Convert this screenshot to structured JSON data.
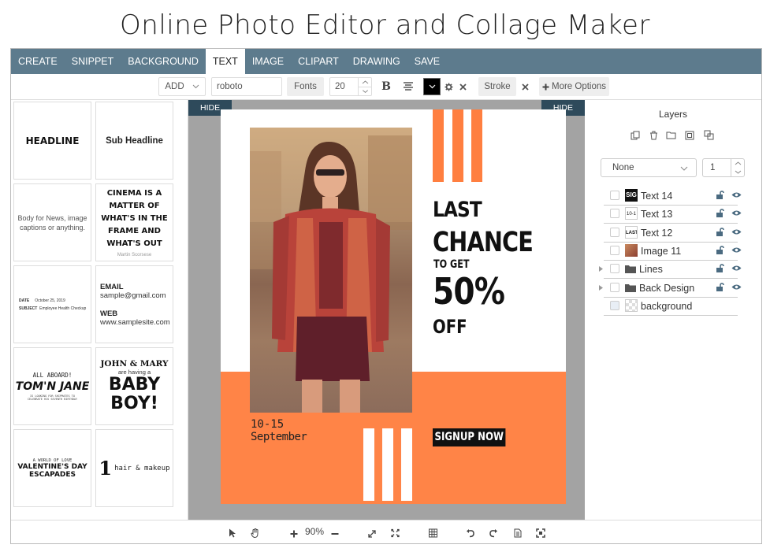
{
  "page": {
    "title": "Online Photo Editor and Collage Maker"
  },
  "menu": {
    "items": [
      {
        "label": "CREATE"
      },
      {
        "label": "SNIPPET"
      },
      {
        "label": "BACKGROUND"
      },
      {
        "label": "TEXT",
        "active": true
      },
      {
        "label": "IMAGE"
      },
      {
        "label": "CLIPART"
      },
      {
        "label": "DRAWING"
      },
      {
        "label": "SAVE"
      }
    ]
  },
  "toolbar": {
    "add_label": "ADD",
    "font_value": "roboto",
    "fonts_label": "Fonts",
    "size_value": "20",
    "bold_icon": "B",
    "align_icon": "align-center-icon",
    "color_value": "#000000",
    "stroke_label": "Stroke",
    "more_options_label": "More Options"
  },
  "templates": {
    "headline": "HEADLINE",
    "sub_headline": "Sub Headline",
    "body": "Body for News, image captions or anything.",
    "quote_lines": [
      "CINEMA IS A",
      "MATTER OF",
      "WHAT'S IN THE",
      "FRAME AND",
      "WHAT'S OUT"
    ],
    "quote_author": "Martin Scorsese",
    "date_label": "DATE",
    "date_value": "October 25, 2019",
    "subject_label": "SUBJECT",
    "subject_value": "Employee Health Checkup",
    "email_label": "EMAIL",
    "email_value": "sample@gmail.com",
    "web_label": "WEB",
    "web_value": "www.samplesite.com",
    "aboard_top": "ALL ABOARD!",
    "aboard_name": "TOM'N JANE",
    "aboard_sub1": "IS LOOKING FOR SHIPMATES TO",
    "aboard_sub2": "CELEBRATE HIS SEVENTH BIRTHDAY",
    "baby_top": "JOHN & MARY",
    "baby_mid": "are having a",
    "baby_big1": "BABY",
    "baby_big2": "BOY!",
    "val_top": "A WORLD OF LOVE",
    "val_mid1": "VALENTINE'S DAY",
    "val_mid2": "ESCAPADES",
    "hair_num": "1",
    "hair_text": "hair & makeup"
  },
  "canvas": {
    "hide_left": "HIDE",
    "hide_right": "HIDE",
    "headline1": "LAST",
    "headline2": "CHANCE",
    "to_get": "TO GET",
    "percent": "50%",
    "off": "OFF",
    "dates": "10-15",
    "month": "September",
    "signup": "SIGNUP NOW",
    "colors": {
      "orange": "#ff8447",
      "bar_orange": "#ff7f40"
    }
  },
  "layers": {
    "title": "Layers",
    "blend_value": "None",
    "opacity_value": "1",
    "items": [
      {
        "name": "Text 14",
        "thumb": "SIG"
      },
      {
        "name": "Text 13",
        "thumb": "10-1"
      },
      {
        "name": "Text 12",
        "thumb": "LAST"
      },
      {
        "name": "Image 11",
        "thumb": ""
      },
      {
        "name": "Lines",
        "thumb": ""
      },
      {
        "name": "Back Design",
        "thumb": ""
      },
      {
        "name": "background",
        "thumb": ""
      }
    ]
  },
  "bottom": {
    "zoom": "90%"
  }
}
